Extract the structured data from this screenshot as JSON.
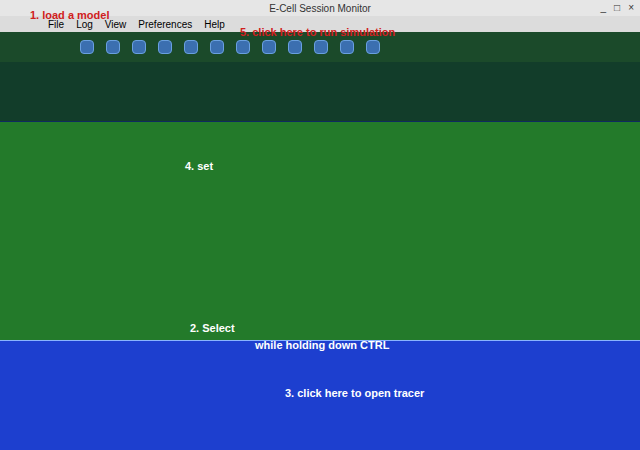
{
  "window": {
    "title": "E-Cell Session Monitor",
    "controls": [
      "_",
      "□",
      "×"
    ]
  },
  "menu": [
    {
      "label": "File"
    },
    {
      "label": "Log"
    },
    {
      "label": "View"
    },
    {
      "label": "Preferences"
    },
    {
      "label": "Help"
    }
  ],
  "annotations": [
    {
      "text": "1. load a model",
      "color": "#d02020"
    },
    {
      "text": "5. click here to run simulation",
      "color": "#d02020"
    },
    {
      "text": "4. set",
      "color": "#ffffff"
    },
    {
      "text": "2. Select",
      "color": "#ffffff"
    },
    {
      "text": "while holding down CTRL",
      "color": "#ffffff"
    },
    {
      "text": "3. click here to open tracer",
      "color": "#ffffff"
    }
  ]
}
